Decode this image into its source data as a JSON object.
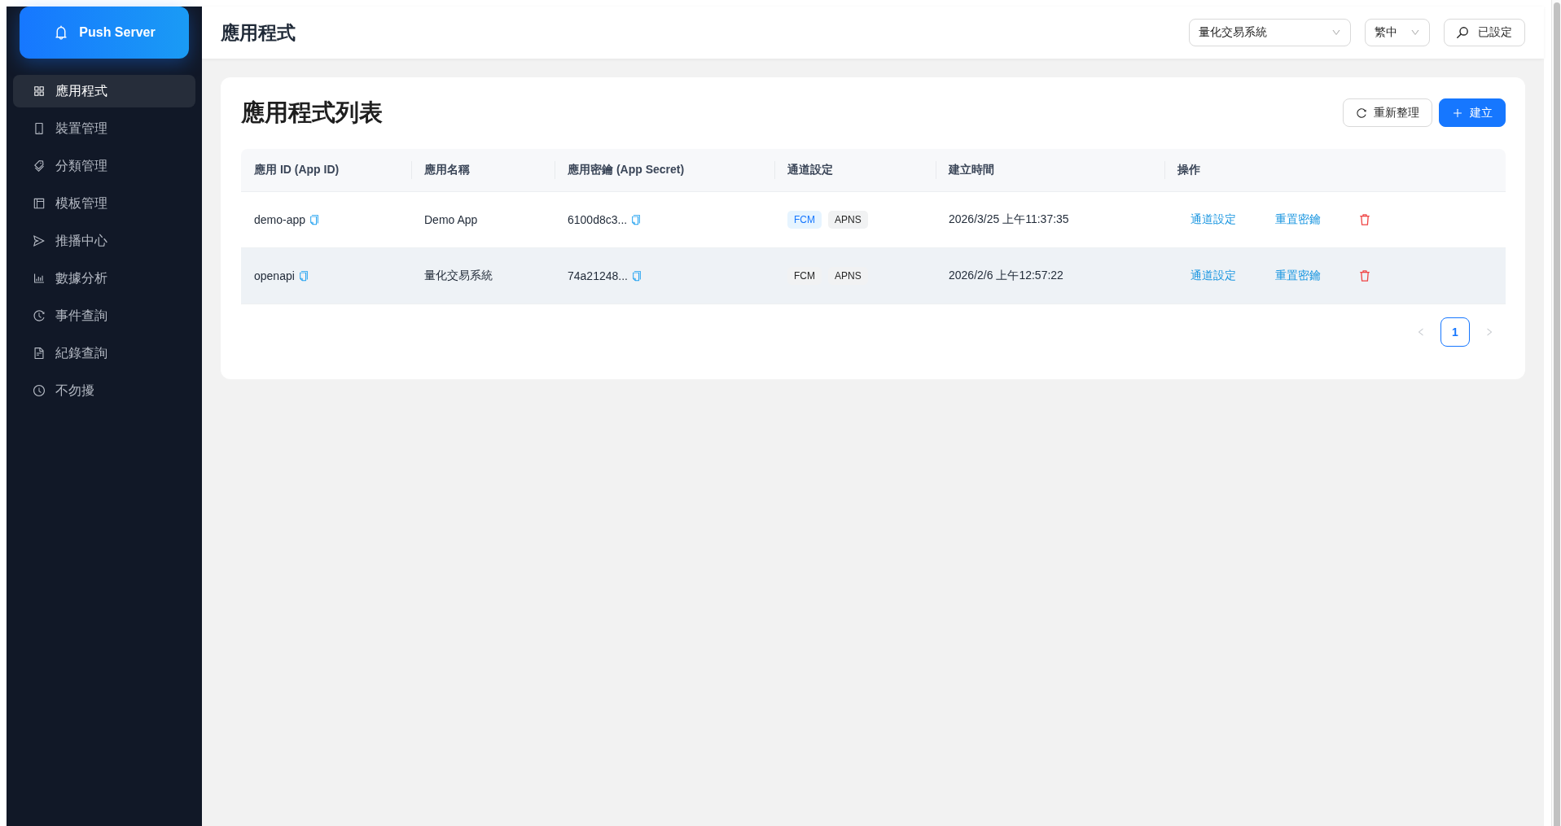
{
  "sidebar": {
    "logo": {
      "title": "Push Server"
    },
    "items": [
      {
        "label": "應用程式",
        "selected": true
      },
      {
        "label": "裝置管理",
        "selected": false
      },
      {
        "label": "分類管理",
        "selected": false
      },
      {
        "label": "模板管理",
        "selected": false
      },
      {
        "label": "推播中心",
        "selected": false
      },
      {
        "label": "數據分析",
        "selected": false
      },
      {
        "label": "事件查詢",
        "selected": false
      },
      {
        "label": "紀錄查詢",
        "selected": false
      },
      {
        "label": "不勿擾",
        "selected": false
      }
    ]
  },
  "header": {
    "title": "應用程式",
    "app_select": {
      "value": "量化交易系統"
    },
    "language_select": {
      "value": "繁中"
    },
    "status_button": {
      "label": "已設定"
    }
  },
  "card": {
    "title": "應用程式列表",
    "buttons": [
      {
        "kind": "default",
        "label": "重新整理"
      },
      {
        "kind": "primary",
        "label": "建立"
      }
    ],
    "table": {
      "columns": [
        "應用 ID (App ID)",
        "應用名稱",
        "應用密鑰 (App Secret)",
        "通道設定",
        "建立時間",
        "操作"
      ],
      "rows": [
        {
          "highlighted": false,
          "app_id": "demo-app",
          "name": "Demo App",
          "secret": "6100d8c3...",
          "channels": [
            {
              "label": "FCM",
              "active": true
            },
            {
              "label": "APNS",
              "active": false
            }
          ],
          "created": "2026/3/25 上午11:37:35",
          "actions": [
            {
              "kind": "link",
              "label": "通道設定"
            },
            {
              "kind": "link",
              "label": "重置密鑰"
            },
            {
              "kind": "delete"
            }
          ]
        },
        {
          "highlighted": true,
          "app_id": "openapi",
          "name": "量化交易系統",
          "secret": "74a21248...",
          "channels": [
            {
              "label": "FCM",
              "active": false
            },
            {
              "label": "APNS",
              "active": false
            }
          ],
          "created": "2026/2/6 上午12:57:22",
          "actions": [
            {
              "kind": "link",
              "label": "通道設定"
            },
            {
              "kind": "link",
              "label": "重置密鑰"
            },
            {
              "kind": "delete"
            }
          ]
        }
      ]
    },
    "pagination": {
      "prev": {
        "disabled": true
      },
      "pages": [
        {
          "label": "1",
          "selected": true
        }
      ],
      "next": {
        "disabled": true
      }
    }
  }
}
